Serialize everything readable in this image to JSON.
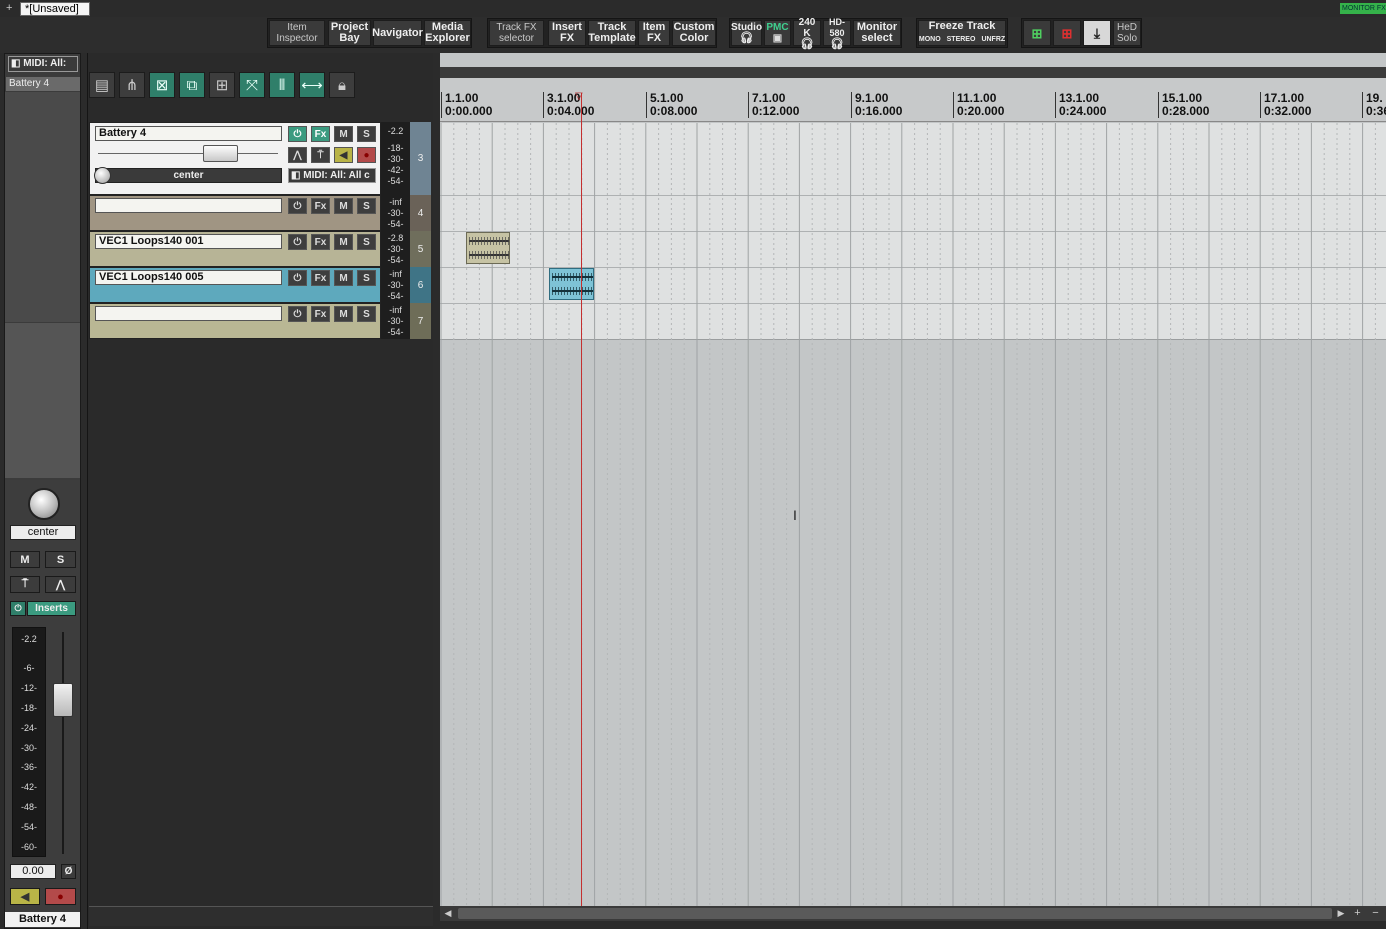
{
  "window": {
    "tab_title": "*[Unsaved]",
    "add_tab": "+",
    "monitor_fx": "MONITOR FX"
  },
  "toolbar": {
    "item_inspector": [
      "Item",
      "Inspector"
    ],
    "project_bay": [
      "Project",
      "Bay"
    ],
    "navigator": "Navigator",
    "media_explorer": [
      "Media",
      "Explorer"
    ],
    "track_fx_selector": [
      "Track FX",
      "selector"
    ],
    "insert_fx": [
      "Insert",
      "FX"
    ],
    "track_template": [
      "Track",
      "Template"
    ],
    "item_fx": [
      "Item",
      "FX"
    ],
    "custom_color": [
      "Custom",
      "Color"
    ],
    "studio": "Studio",
    "pmc": "PMC",
    "k240": "240 K",
    "hd580": "HD-580",
    "monitor_select": [
      "Monitor",
      "select"
    ],
    "freeze_track": "Freeze Track",
    "freeze_mono": "MONO",
    "freeze_stereo": "STEREO",
    "freeze_unfrz": "UNFRZ",
    "hed_solo": [
      "HeD",
      "Solo"
    ]
  },
  "left_panel": {
    "midi_input": "MIDI: All:",
    "track_name": "Battery 4"
  },
  "tracks": [
    {
      "num": "3",
      "name": "Battery 4",
      "pan": "center",
      "input": "MIDI: All: All c",
      "meter": [
        "-2.2",
        "-18-",
        "-30-",
        "-42-",
        "-54-"
      ],
      "color": "#f2f2f2"
    },
    {
      "num": "4",
      "name": "",
      "meter": [
        "-inf",
        "-30-",
        "-54-"
      ],
      "color": "#a09583"
    },
    {
      "num": "5",
      "name": "VEC1 Loops140 001",
      "meter": [
        "-2.8",
        "-30-",
        "-54-"
      ],
      "color": "#b7b496"
    },
    {
      "num": "6",
      "name": "VEC1 Loops140 005",
      "meter": [
        "-inf",
        "-30-",
        "-54-"
      ],
      "color": "#5ea9bd"
    },
    {
      "num": "7",
      "name": "",
      "meter": [
        "-inf",
        "-30-",
        "-54-"
      ],
      "color": "#b9b794"
    }
  ],
  "track_buttons": {
    "fx": "Fx",
    "mute": "M",
    "solo": "S"
  },
  "ruler": [
    {
      "bar": "1.1.00",
      "time": "0:00.000"
    },
    {
      "bar": "3.1.00",
      "time": "0:04.000"
    },
    {
      "bar": "5.1.00",
      "time": "0:08.000"
    },
    {
      "bar": "7.1.00",
      "time": "0:12.000"
    },
    {
      "bar": "9.1.00",
      "time": "0:16.000"
    },
    {
      "bar": "11.1.00",
      "time": "0:20.000"
    },
    {
      "bar": "13.1.00",
      "time": "0:24.000"
    },
    {
      "bar": "15.1.00",
      "time": "0:28.000"
    },
    {
      "bar": "17.1.00",
      "time": "0:32.000"
    },
    {
      "bar": "19.",
      "time": "0:36"
    }
  ],
  "mixer": {
    "pan": "center",
    "mute": "M",
    "solo": "S",
    "inserts": "Inserts",
    "peak": "-2.2",
    "scale": [
      "-6-",
      "-12-",
      "-18-",
      "-24-",
      "-30-",
      "-36-",
      "-42-",
      "-48-",
      "-54-",
      "-60-"
    ],
    "volume": "0.00",
    "phase": "Ø",
    "track_name": "Battery 4"
  },
  "colors": {
    "accent": "#3b9b80",
    "playhead": "#c43030",
    "arrange_bg": "#c3c6c7",
    "active_area": "#dfe1e1"
  }
}
